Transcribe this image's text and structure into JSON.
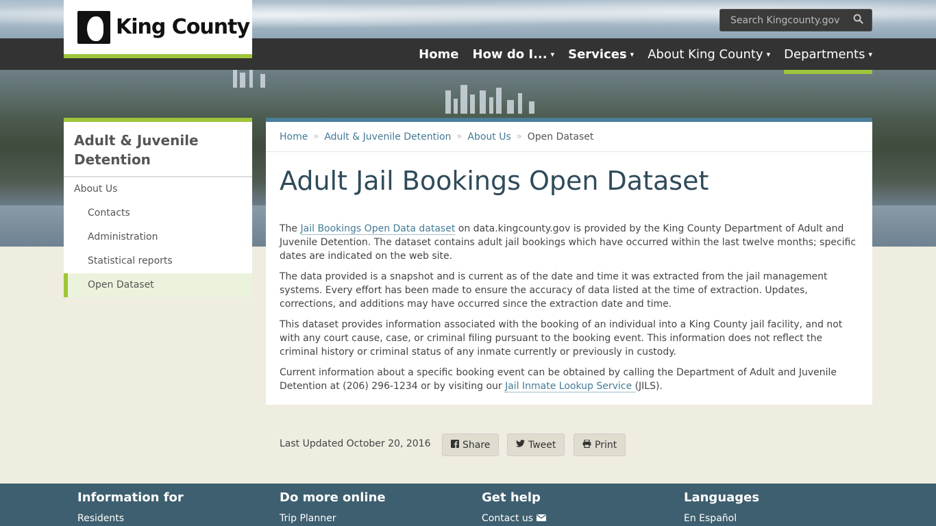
{
  "brand": {
    "name": "King County"
  },
  "search": {
    "placeholder": "Search Kingcounty.gov"
  },
  "nav": {
    "items": [
      {
        "label": "Home",
        "bold": true,
        "caret": false
      },
      {
        "label": "How do I...",
        "bold": true,
        "caret": true
      },
      {
        "label": "Services",
        "bold": true,
        "caret": true
      },
      {
        "label": "About King County",
        "bold": false,
        "caret": true
      },
      {
        "label": "Departments",
        "bold": false,
        "caret": true
      }
    ],
    "caret_glyph": "▾"
  },
  "sidebar": {
    "title": "Adult & Juvenile Detention",
    "items": [
      {
        "label": "About Us"
      },
      {
        "label": "Contacts"
      },
      {
        "label": "Administration"
      },
      {
        "label": "Statistical reports"
      },
      {
        "label": "Open Dataset"
      }
    ]
  },
  "breadcrumb": {
    "sep": "»",
    "items": [
      "Home",
      "Adult & Juvenile Detention",
      "About Us",
      "Open Dataset"
    ]
  },
  "page": {
    "title": "Adult Jail Bookings Open Dataset",
    "p1_pre": "The ",
    "p1_link": "Jail Bookings Open Data dataset",
    "p1_post": " on data.kingcounty.gov is provided by the King County Department of Adult and Juvenile Detention. The dataset contains adult jail bookings which have occurred within the last twelve months; specific dates are indicated on the web site.",
    "p2": "The data provided is a snapshot and is current as of the date and time it was extracted from the jail management systems. Every effort has been made to ensure the accuracy of data listed at the time of extraction. Updates, corrections, and additions may have occurred since the extraction date and time.",
    "p3": "This dataset provides information associated with the booking of an individual into a King County jail facility, and not with any court cause, case, or criminal filing pursuant to the booking event. This information does not reflect the criminal history or criminal status of any inmate currently or previously in custody.",
    "p4_pre": "Current information about a specific booking event can be obtained by calling the Department of Adult and Juvenile Detention at (206) 296-1234 or by visiting our ",
    "p4_link": "Jail Inmate Lookup Service ",
    "p4_post": "(JILS)."
  },
  "meta": {
    "updated": "Last Updated October 20, 2016"
  },
  "share": {
    "share_label": "Share",
    "tweet_label": "Tweet",
    "print_label": "Print"
  },
  "footer": {
    "cols": [
      {
        "heading": "Information for",
        "link": "Residents"
      },
      {
        "heading": "Do more online",
        "link": "Trip Planner"
      },
      {
        "heading": "Get help",
        "link": "Contact us"
      },
      {
        "heading": "Languages",
        "link": "En Español"
      }
    ]
  },
  "colors": {
    "accent": "#9ec53b",
    "link": "#437a96",
    "topbar": "#333333",
    "footer": "#3e5f6f"
  }
}
